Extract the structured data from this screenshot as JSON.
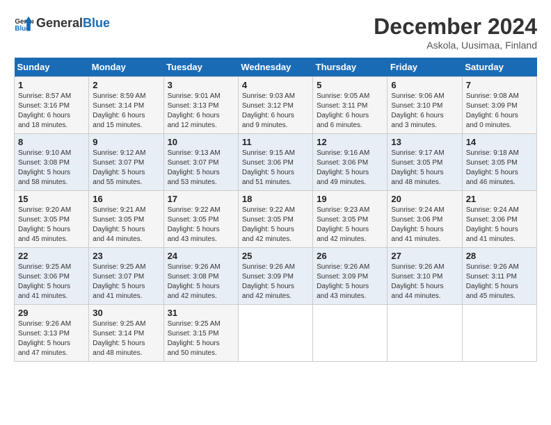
{
  "header": {
    "logo_general": "General",
    "logo_blue": "Blue",
    "title": "December 2024",
    "subtitle": "Askola, Uusimaa, Finland"
  },
  "days_of_week": [
    "Sunday",
    "Monday",
    "Tuesday",
    "Wednesday",
    "Thursday",
    "Friday",
    "Saturday"
  ],
  "weeks": [
    [
      {
        "day": "1",
        "info": "Sunrise: 8:57 AM\nSunset: 3:16 PM\nDaylight: 6 hours\nand 18 minutes."
      },
      {
        "day": "2",
        "info": "Sunrise: 8:59 AM\nSunset: 3:14 PM\nDaylight: 6 hours\nand 15 minutes."
      },
      {
        "day": "3",
        "info": "Sunrise: 9:01 AM\nSunset: 3:13 PM\nDaylight: 6 hours\nand 12 minutes."
      },
      {
        "day": "4",
        "info": "Sunrise: 9:03 AM\nSunset: 3:12 PM\nDaylight: 6 hours\nand 9 minutes."
      },
      {
        "day": "5",
        "info": "Sunrise: 9:05 AM\nSunset: 3:11 PM\nDaylight: 6 hours\nand 6 minutes."
      },
      {
        "day": "6",
        "info": "Sunrise: 9:06 AM\nSunset: 3:10 PM\nDaylight: 6 hours\nand 3 minutes."
      },
      {
        "day": "7",
        "info": "Sunrise: 9:08 AM\nSunset: 3:09 PM\nDaylight: 6 hours\nand 0 minutes."
      }
    ],
    [
      {
        "day": "8",
        "info": "Sunrise: 9:10 AM\nSunset: 3:08 PM\nDaylight: 5 hours\nand 58 minutes."
      },
      {
        "day": "9",
        "info": "Sunrise: 9:12 AM\nSunset: 3:07 PM\nDaylight: 5 hours\nand 55 minutes."
      },
      {
        "day": "10",
        "info": "Sunrise: 9:13 AM\nSunset: 3:07 PM\nDaylight: 5 hours\nand 53 minutes."
      },
      {
        "day": "11",
        "info": "Sunrise: 9:15 AM\nSunset: 3:06 PM\nDaylight: 5 hours\nand 51 minutes."
      },
      {
        "day": "12",
        "info": "Sunrise: 9:16 AM\nSunset: 3:06 PM\nDaylight: 5 hours\nand 49 minutes."
      },
      {
        "day": "13",
        "info": "Sunrise: 9:17 AM\nSunset: 3:05 PM\nDaylight: 5 hours\nand 48 minutes."
      },
      {
        "day": "14",
        "info": "Sunrise: 9:18 AM\nSunset: 3:05 PM\nDaylight: 5 hours\nand 46 minutes."
      }
    ],
    [
      {
        "day": "15",
        "info": "Sunrise: 9:20 AM\nSunset: 3:05 PM\nDaylight: 5 hours\nand 45 minutes."
      },
      {
        "day": "16",
        "info": "Sunrise: 9:21 AM\nSunset: 3:05 PM\nDaylight: 5 hours\nand 44 minutes."
      },
      {
        "day": "17",
        "info": "Sunrise: 9:22 AM\nSunset: 3:05 PM\nDaylight: 5 hours\nand 43 minutes."
      },
      {
        "day": "18",
        "info": "Sunrise: 9:22 AM\nSunset: 3:05 PM\nDaylight: 5 hours\nand 42 minutes."
      },
      {
        "day": "19",
        "info": "Sunrise: 9:23 AM\nSunset: 3:05 PM\nDaylight: 5 hours\nand 42 minutes."
      },
      {
        "day": "20",
        "info": "Sunrise: 9:24 AM\nSunset: 3:06 PM\nDaylight: 5 hours\nand 41 minutes."
      },
      {
        "day": "21",
        "info": "Sunrise: 9:24 AM\nSunset: 3:06 PM\nDaylight: 5 hours\nand 41 minutes."
      }
    ],
    [
      {
        "day": "22",
        "info": "Sunrise: 9:25 AM\nSunset: 3:06 PM\nDaylight: 5 hours\nand 41 minutes."
      },
      {
        "day": "23",
        "info": "Sunrise: 9:25 AM\nSunset: 3:07 PM\nDaylight: 5 hours\nand 41 minutes."
      },
      {
        "day": "24",
        "info": "Sunrise: 9:26 AM\nSunset: 3:08 PM\nDaylight: 5 hours\nand 42 minutes."
      },
      {
        "day": "25",
        "info": "Sunrise: 9:26 AM\nSunset: 3:09 PM\nDaylight: 5 hours\nand 42 minutes."
      },
      {
        "day": "26",
        "info": "Sunrise: 9:26 AM\nSunset: 3:09 PM\nDaylight: 5 hours\nand 43 minutes."
      },
      {
        "day": "27",
        "info": "Sunrise: 9:26 AM\nSunset: 3:10 PM\nDaylight: 5 hours\nand 44 minutes."
      },
      {
        "day": "28",
        "info": "Sunrise: 9:26 AM\nSunset: 3:11 PM\nDaylight: 5 hours\nand 45 minutes."
      }
    ],
    [
      {
        "day": "29",
        "info": "Sunrise: 9:26 AM\nSunset: 3:13 PM\nDaylight: 5 hours\nand 47 minutes."
      },
      {
        "day": "30",
        "info": "Sunrise: 9:25 AM\nSunset: 3:14 PM\nDaylight: 5 hours\nand 48 minutes."
      },
      {
        "day": "31",
        "info": "Sunrise: 9:25 AM\nSunset: 3:15 PM\nDaylight: 5 hours\nand 50 minutes."
      },
      {
        "day": "",
        "info": ""
      },
      {
        "day": "",
        "info": ""
      },
      {
        "day": "",
        "info": ""
      },
      {
        "day": "",
        "info": ""
      }
    ]
  ]
}
